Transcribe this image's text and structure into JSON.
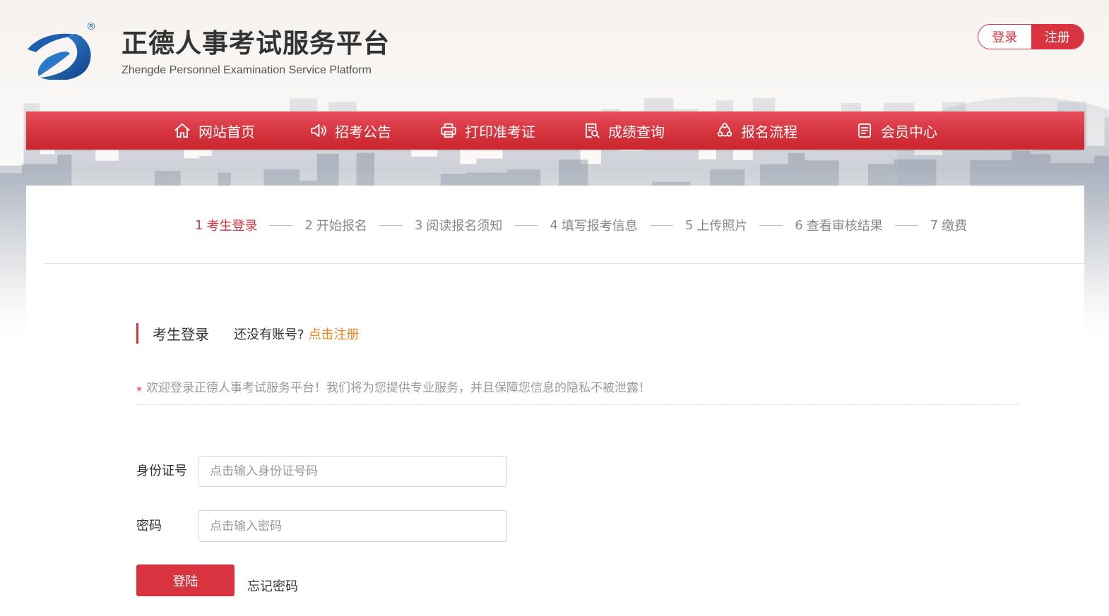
{
  "header": {
    "logo": {
      "icon": "zd-swirl-logo",
      "registered_mark": "®"
    },
    "title": "正德人事考试服务平台",
    "subtitle": "Zhengde Personnel Examination Service Platform",
    "auth": {
      "login_label": "登录",
      "register_label": "注册"
    }
  },
  "nav": {
    "items": [
      {
        "label": "网站首页",
        "icon": "home-icon"
      },
      {
        "label": "招考公告",
        "icon": "speaker-icon"
      },
      {
        "label": "打印准考证",
        "icon": "printer-icon"
      },
      {
        "label": "成绩查询",
        "icon": "document-search-icon"
      },
      {
        "label": "报名流程",
        "icon": "flow-icon"
      },
      {
        "label": "会员中心",
        "icon": "member-document-icon"
      }
    ]
  },
  "steps": {
    "items": [
      {
        "number": "1",
        "label": "考生登录",
        "current": true
      },
      {
        "number": "2",
        "label": "开始报名"
      },
      {
        "number": "3",
        "label": "阅读报名须知"
      },
      {
        "number": "4",
        "label": "填写报考信息"
      },
      {
        "number": "5",
        "label": "上传照片"
      },
      {
        "number": "6",
        "label": "查看审核结果"
      },
      {
        "number": "7",
        "label": "缴费"
      }
    ]
  },
  "login": {
    "section_title": "考生登录",
    "no_account_text": "还没有账号?",
    "register_link": "点击注册",
    "notice_mark": "*",
    "notice": "欢迎登录正德人事考试服务平台！我们将为您提供专业服务，并且保障您信息的隐私不被泄露！",
    "id_label": "身份证号",
    "id_placeholder": "点击输入身份证号码",
    "id_value": "",
    "password_label": "密码",
    "password_placeholder": "点击输入密码",
    "password_value": "",
    "submit_label": "登陆",
    "forgot_label": "忘记密码"
  },
  "colors": {
    "brand_red": "#d9333f",
    "link_orange": "#f08519",
    "logo_blue": "#1d5fae"
  }
}
